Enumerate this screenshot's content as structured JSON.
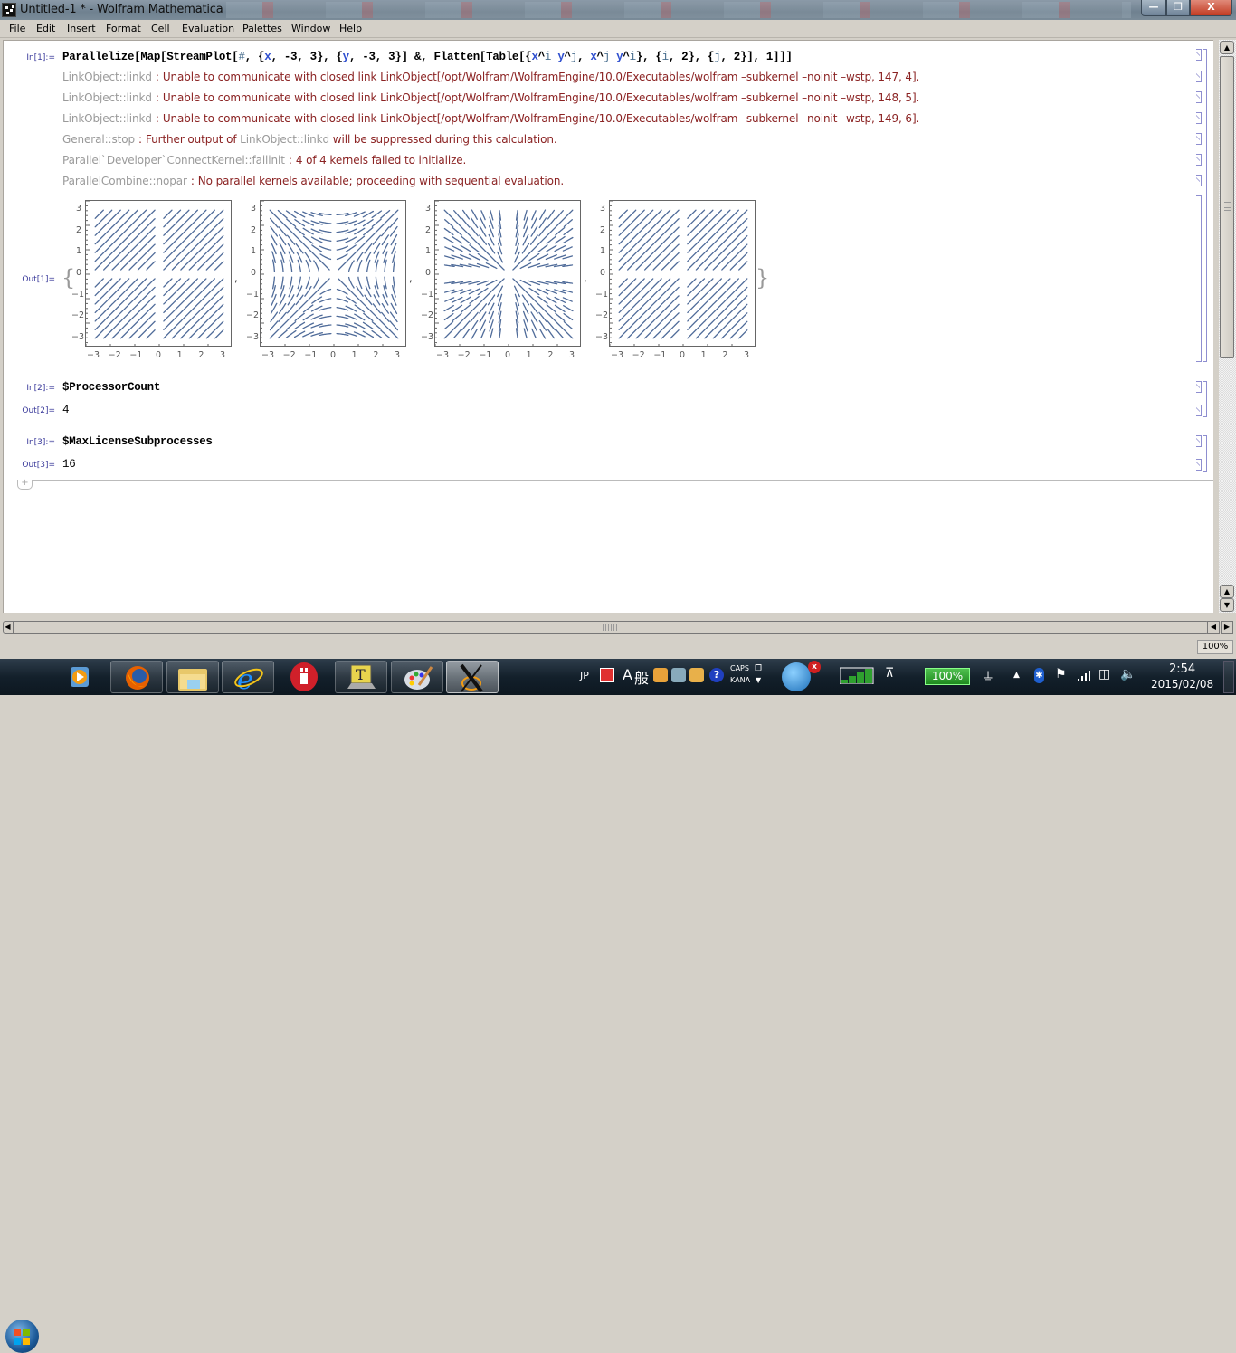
{
  "window": {
    "title": "Untitled-1 * - Wolfram Mathematica"
  },
  "menubar": {
    "items": [
      "File",
      "Edit",
      "Insert",
      "Format",
      "Cell",
      "Evaluation",
      "Palettes",
      "Window",
      "Help"
    ]
  },
  "cells": {
    "in1": {
      "label": "In[1]:=",
      "code_parts": [
        "Parallelize[Map[StreamPlot[",
        "#",
        ", {",
        "x",
        ", -3, 3}, {",
        "y",
        ", -3, 3}] &, Flatten[Table[{",
        "x",
        "^",
        "i",
        " ",
        "y",
        "^",
        "j",
        ", ",
        "x",
        "^",
        "j",
        " ",
        "y",
        "^",
        "i",
        "}, {",
        "i",
        ", 2}, {",
        "j",
        ", 2}], 1]]]"
      ]
    },
    "messages": [
      {
        "tag": "LinkObject::linkd",
        "text": "Unable to communicate with closed link LinkObject[/opt/Wolfram/WolframEngine/10.0/Executables/wolfram –subkernel –noinit –wstp, 147, 4]."
      },
      {
        "tag": "LinkObject::linkd",
        "text": "Unable to communicate with closed link LinkObject[/opt/Wolfram/WolframEngine/10.0/Executables/wolfram –subkernel –noinit –wstp, 148, 5]."
      },
      {
        "tag": "LinkObject::linkd",
        "text": "Unable to communicate with closed link LinkObject[/opt/Wolfram/WolframEngine/10.0/Executables/wolfram –subkernel –noinit –wstp, 149, 6]."
      },
      {
        "tag": "General::stop",
        "text_pre": "Further output of ",
        "inline_tag": "LinkObject::linkd",
        "text_post": " will be suppressed during this calculation."
      },
      {
        "tag": "Parallel`Developer`ConnectKernel::failinit",
        "text": "4 of 4 kernels failed to initialize."
      },
      {
        "tag": "ParallelCombine::nopar",
        "text": "No parallel kernels available; proceeding with sequential evaluation."
      }
    ],
    "out1": {
      "label": "Out[1]=",
      "open_brace": "{",
      "close_brace": "}",
      "separator": ","
    },
    "in2": {
      "label": "In[2]:=",
      "code": "$ProcessorCount"
    },
    "out2": {
      "label": "Out[2]=",
      "value": "4"
    },
    "in3": {
      "label": "In[3]:=",
      "code": "$MaxLicenseSubprocesses"
    },
    "out3": {
      "label": "Out[3]=",
      "value": "16"
    },
    "insert_icon": "+"
  },
  "chart_data": [
    {
      "type": "streamplot",
      "field": [
        "x y",
        "x y"
      ],
      "xrange": [
        -3,
        3
      ],
      "yrange": [
        -3,
        3
      ],
      "xticks": [
        "-3",
        "-2",
        "-1",
        "0",
        "1",
        "2",
        "3"
      ],
      "yticks": [
        "3",
        "2",
        "1",
        "0",
        "-1",
        "-2",
        "-3"
      ],
      "color": "#4f6b99"
    },
    {
      "type": "streamplot",
      "field": [
        "x y^2",
        "x^2 y"
      ],
      "xrange": [
        -3,
        3
      ],
      "yrange": [
        -3,
        3
      ],
      "xticks": [
        "-3",
        "-2",
        "-1",
        "0",
        "1",
        "2",
        "3"
      ],
      "yticks": [
        "3",
        "2",
        "1",
        "0",
        "-1",
        "-2",
        "-3"
      ],
      "color": "#4f6b99"
    },
    {
      "type": "streamplot",
      "field": [
        "x^2 y",
        "x y^2"
      ],
      "xrange": [
        -3,
        3
      ],
      "yrange": [
        -3,
        3
      ],
      "xticks": [
        "-3",
        "-2",
        "-1",
        "0",
        "1",
        "2",
        "3"
      ],
      "yticks": [
        "3",
        "2",
        "1",
        "0",
        "-1",
        "-2",
        "-3"
      ],
      "color": "#4f6b99"
    },
    {
      "type": "streamplot",
      "field": [
        "x^2 y^2",
        "x^2 y^2"
      ],
      "xrange": [
        -3,
        3
      ],
      "yrange": [
        -3,
        3
      ],
      "xticks": [
        "-3",
        "-2",
        "-1",
        "0",
        "1",
        "2",
        "3"
      ],
      "yticks": [
        "3",
        "2",
        "1",
        "0",
        "-1",
        "-2",
        "-3"
      ],
      "color": "#4f6b99"
    }
  ],
  "statusbar": {
    "zoom": "100%"
  },
  "taskbar": {
    "apps": [
      "windows-media-player",
      "firefox",
      "file-explorer",
      "internet-explorer",
      "red-hand-app",
      "text-editor-app",
      "paint-app",
      "x-server-app"
    ],
    "tray": {
      "ime_lang": "JP",
      "ime_mode": "A",
      "ime_kanji": "般",
      "caps": "CAPS",
      "kana": "KANA",
      "battery": "100%",
      "time": "2:54",
      "date": "2015/02/08"
    }
  }
}
